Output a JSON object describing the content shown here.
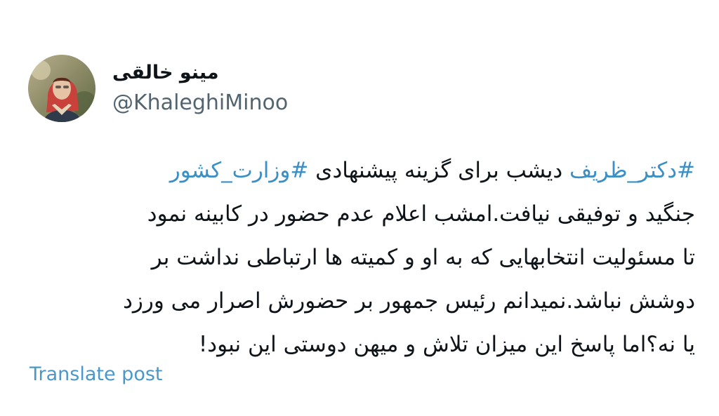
{
  "post": {
    "author": {
      "display_name": "مینو خالقی",
      "handle": "@KhaleghiMinoo",
      "avatar_icon": "profile-photo"
    },
    "body": {
      "line1": {
        "hashtag1": "#دکتر_ظریف",
        "text": " دیشب برای گزینه پیشنهادی ",
        "hashtag2": "#وزارت_کشور"
      },
      "line2": "جنگید و توفیقی نیافت.امشب اعلام عدم حضور در کابینه نمود",
      "line3": "تا مسئولیت انتخابهایی که به او و کمیته ها ارتباطی نداشت بر",
      "line4": "دوشش نباشد.نمیدانم رئیس جمهور بر حضورش اصرار می ورزد",
      "line5": "یا نه؟اما پاسخ این میزان تلاش و میهن دوستی این نبود!"
    },
    "translate_label": "Translate post",
    "colors": {
      "hashtag": "#3a8fc4",
      "translate": "#4b98c8",
      "handle": "#536471",
      "text": "#0f1419"
    }
  }
}
